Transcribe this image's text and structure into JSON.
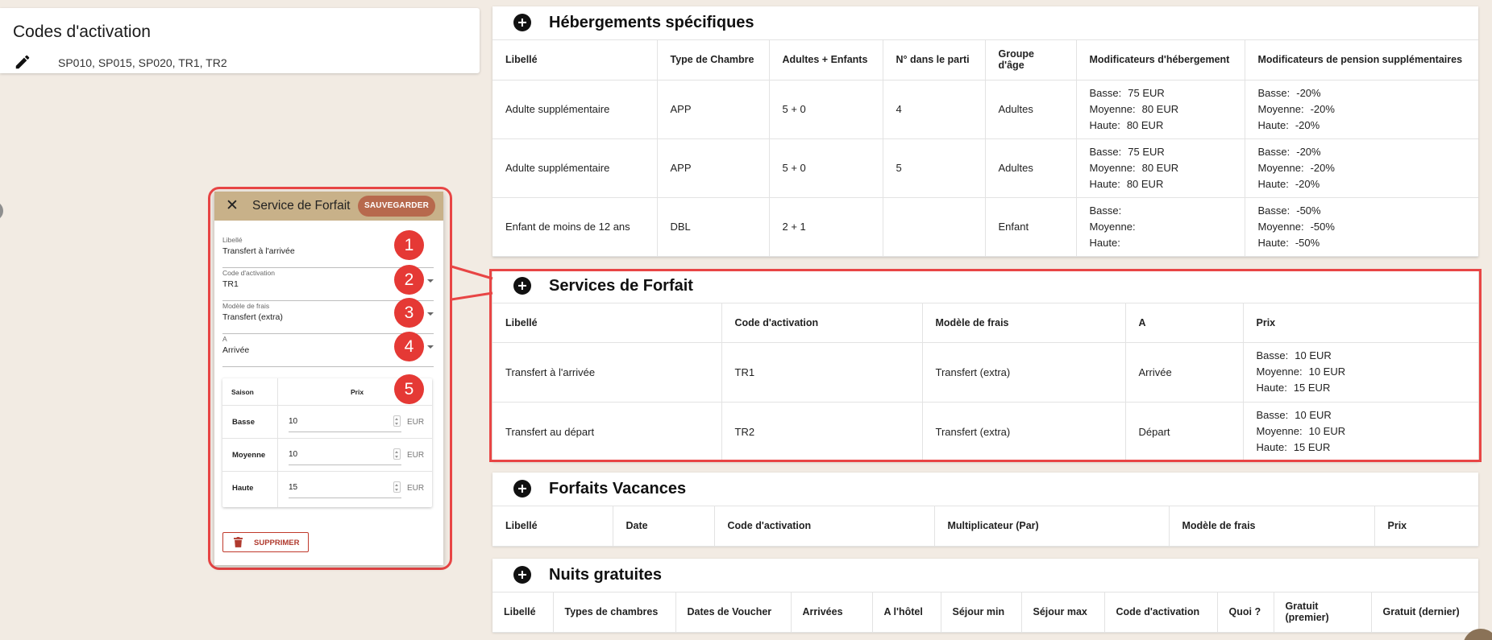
{
  "activation_codes": {
    "title": "Codes d'activation",
    "edit_icon": "pencil-icon",
    "codes": "SP010, SP015, SP020, TR1, TR2"
  },
  "specific_accommodations": {
    "title": "Hébergements spécifiques",
    "columns": [
      "Libellé",
      "Type de Chambre",
      "Adultes + Enfants",
      "N° dans le parti",
      "Groupe d'âge",
      "Modificateurs d'hébergement",
      "Modificateurs de pension supplémentaires"
    ],
    "rows": [
      {
        "label": "Adulte supplémentaire",
        "room_type": "APP",
        "adults_children": "5 + 0",
        "party_number": "4",
        "age_group": "Adultes",
        "acc_mod": [
          {
            "k": "Basse:",
            "v": "75 EUR"
          },
          {
            "k": "Moyenne:",
            "v": "80 EUR"
          },
          {
            "k": "Haute:",
            "v": "80 EUR"
          }
        ],
        "board_mod": [
          {
            "k": "Basse:",
            "v": "-20%"
          },
          {
            "k": "Moyenne:",
            "v": "-20%"
          },
          {
            "k": "Haute:",
            "v": "-20%"
          }
        ]
      },
      {
        "label": "Adulte supplémentaire",
        "room_type": "APP",
        "adults_children": "5 + 0",
        "party_number": "5",
        "age_group": "Adultes",
        "acc_mod": [
          {
            "k": "Basse:",
            "v": "75 EUR"
          },
          {
            "k": "Moyenne:",
            "v": "80 EUR"
          },
          {
            "k": "Haute:",
            "v": "80 EUR"
          }
        ],
        "board_mod": [
          {
            "k": "Basse:",
            "v": "-20%"
          },
          {
            "k": "Moyenne:",
            "v": "-20%"
          },
          {
            "k": "Haute:",
            "v": "-20%"
          }
        ]
      },
      {
        "label": "Enfant de moins de 12 ans",
        "room_type": "DBL",
        "adults_children": "2 + 1",
        "party_number": "",
        "age_group": "Enfant",
        "acc_mod": [
          {
            "k": "Basse:",
            "v": ""
          },
          {
            "k": "Moyenne:",
            "v": ""
          },
          {
            "k": "Haute:",
            "v": ""
          }
        ],
        "board_mod": [
          {
            "k": "Basse:",
            "v": "-50%"
          },
          {
            "k": "Moyenne:",
            "v": "-50%"
          },
          {
            "k": "Haute:",
            "v": "-50%"
          }
        ]
      }
    ]
  },
  "package_services": {
    "title": "Services de Forfait",
    "columns": [
      "Libellé",
      "Code d'activation",
      "Modèle de frais",
      "A",
      "Prix"
    ],
    "rows": [
      {
        "label": "Transfert à l'arrivée",
        "code": "TR1",
        "fee_model": "Transfert (extra)",
        "when": "Arrivée",
        "price": [
          {
            "k": "Basse:",
            "v": "10 EUR"
          },
          {
            "k": "Moyenne:",
            "v": "10 EUR"
          },
          {
            "k": "Haute:",
            "v": "15 EUR"
          }
        ]
      },
      {
        "label": "Transfert au départ",
        "code": "TR2",
        "fee_model": "Transfert (extra)",
        "when": "Départ",
        "price": [
          {
            "k": "Basse:",
            "v": "10 EUR"
          },
          {
            "k": "Moyenne:",
            "v": "10 EUR"
          },
          {
            "k": "Haute:",
            "v": "15 EUR"
          }
        ]
      }
    ]
  },
  "holiday_packages": {
    "title": "Forfaits Vacances",
    "columns": [
      "Libellé",
      "Date",
      "Code d'activation",
      "Multiplicateur (Par)",
      "Modèle de frais",
      "Prix"
    ]
  },
  "free_nights": {
    "title": "Nuits gratuites",
    "columns": [
      "Libellé",
      "Types de chambres",
      "Dates de Voucher",
      "Arrivées",
      "A l'hôtel",
      "Séjour min",
      "Séjour max",
      "Code d'activation",
      "Quoi ?",
      "Gratuit (premier)",
      "Gratuit (dernier)"
    ]
  },
  "popup": {
    "close_icon": "close-icon",
    "title": "Service de Forfait",
    "save_label": "SAUVEGARDER",
    "fields": [
      {
        "label": "Libellé",
        "value": "Transfert à l'arrivée"
      },
      {
        "label": "Code d'activation",
        "value": "TR1"
      },
      {
        "label": "Modèle de frais",
        "value": "Transfert (extra)"
      },
      {
        "label": "A",
        "value": "Arrivée"
      }
    ],
    "season_table": {
      "col_season": "Saison",
      "col_price": "Prix",
      "rows": [
        {
          "season": "Basse",
          "price": "10",
          "unit": "EUR"
        },
        {
          "season": "Moyenne",
          "price": "10",
          "unit": "EUR"
        },
        {
          "season": "Haute",
          "price": "15",
          "unit": "EUR"
        }
      ]
    },
    "delete_label": "SUPPRIMER",
    "badges": [
      "1",
      "2",
      "3",
      "4",
      "5"
    ]
  },
  "colors": {
    "background": "#f2ebe3",
    "popup_header": "#c8b189",
    "save_button": "#b7694d",
    "highlight": "#e84545",
    "badge": "#e53935"
  }
}
